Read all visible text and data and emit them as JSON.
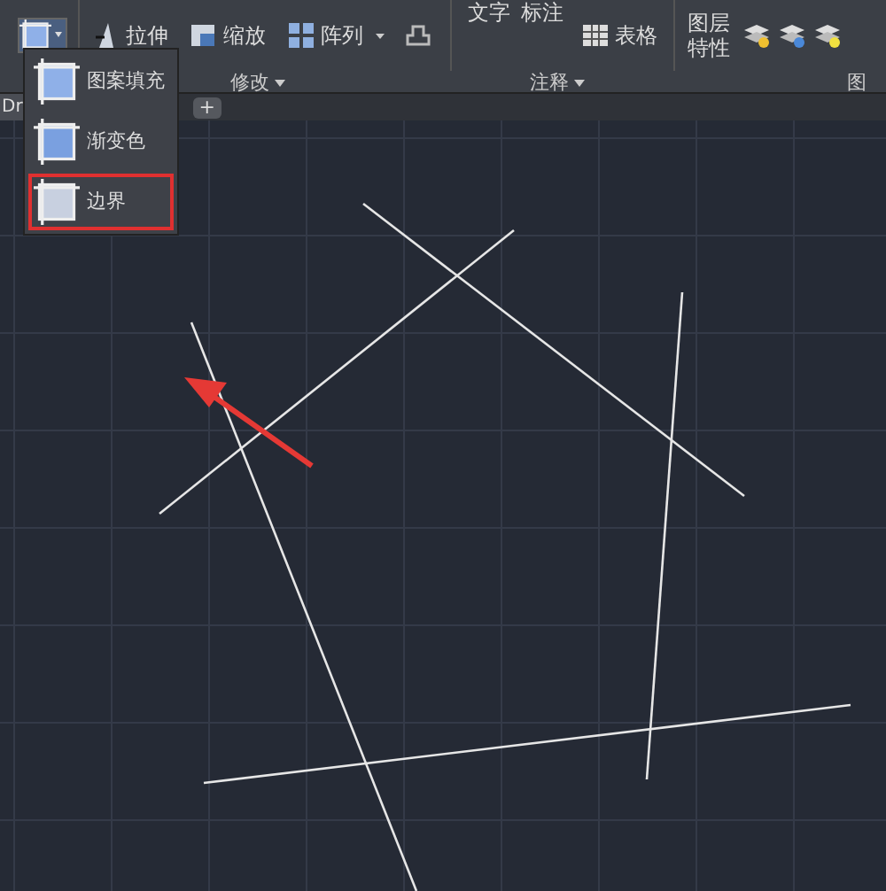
{
  "ribbon": {
    "modify_tools": [
      {
        "label": "拉伸",
        "kind": "stretch",
        "caret": false
      },
      {
        "label": "缩放",
        "kind": "scale",
        "caret": false
      },
      {
        "label": "阵列",
        "kind": "array",
        "caret": true
      }
    ],
    "annotation_tools": {
      "text": "文字",
      "dimension": "标注",
      "table": "表格"
    },
    "layer_tool": "图层特性",
    "panels": [
      {
        "label": "修改",
        "caret": true
      },
      {
        "label": "注释",
        "caret": true
      },
      {
        "label": "图",
        "caret": false
      }
    ]
  },
  "file_tab": {
    "label": "Dr"
  },
  "new_tab": "+",
  "flyout": [
    {
      "label": "图案填充",
      "kind": "hatch",
      "selected": false
    },
    {
      "label": "渐变色",
      "kind": "gradient",
      "selected": false
    },
    {
      "label": "边界",
      "kind": "boundary",
      "selected": true
    }
  ]
}
